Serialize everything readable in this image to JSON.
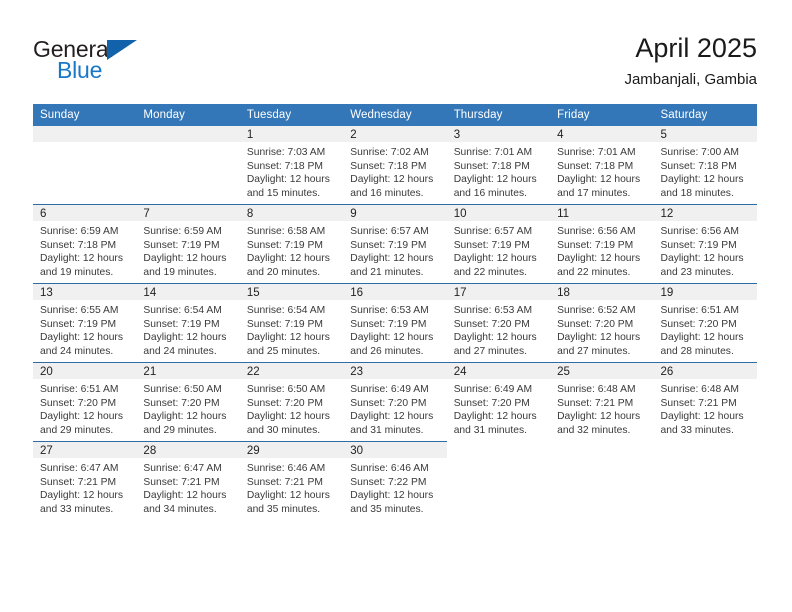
{
  "brand": {
    "name_part1": "General",
    "name_part2": "Blue",
    "triangle_icon": "triangle-icon",
    "accent_color": "#1162ab",
    "blue_text_color": "#1878c8"
  },
  "header": {
    "title": "April 2025",
    "location": "Jambanjali, Gambia"
  },
  "calendar": {
    "header_background": "#3477b8",
    "daynum_background": "#f0f0f0",
    "row_separator_color": "#2e6da4",
    "weekdays": [
      "Sunday",
      "Monday",
      "Tuesday",
      "Wednesday",
      "Thursday",
      "Friday",
      "Saturday"
    ],
    "weeks": [
      [
        {
          "day": "",
          "empty": true
        },
        {
          "day": "",
          "empty": true
        },
        {
          "day": "1",
          "sunrise": "Sunrise: 7:03 AM",
          "sunset": "Sunset: 7:18 PM",
          "daylight": "Daylight: 12 hours and 15 minutes."
        },
        {
          "day": "2",
          "sunrise": "Sunrise: 7:02 AM",
          "sunset": "Sunset: 7:18 PM",
          "daylight": "Daylight: 12 hours and 16 minutes."
        },
        {
          "day": "3",
          "sunrise": "Sunrise: 7:01 AM",
          "sunset": "Sunset: 7:18 PM",
          "daylight": "Daylight: 12 hours and 16 minutes."
        },
        {
          "day": "4",
          "sunrise": "Sunrise: 7:01 AM",
          "sunset": "Sunset: 7:18 PM",
          "daylight": "Daylight: 12 hours and 17 minutes."
        },
        {
          "day": "5",
          "sunrise": "Sunrise: 7:00 AM",
          "sunset": "Sunset: 7:18 PM",
          "daylight": "Daylight: 12 hours and 18 minutes."
        }
      ],
      [
        {
          "day": "6",
          "sunrise": "Sunrise: 6:59 AM",
          "sunset": "Sunset: 7:18 PM",
          "daylight": "Daylight: 12 hours and 19 minutes."
        },
        {
          "day": "7",
          "sunrise": "Sunrise: 6:59 AM",
          "sunset": "Sunset: 7:19 PM",
          "daylight": "Daylight: 12 hours and 19 minutes."
        },
        {
          "day": "8",
          "sunrise": "Sunrise: 6:58 AM",
          "sunset": "Sunset: 7:19 PM",
          "daylight": "Daylight: 12 hours and 20 minutes."
        },
        {
          "day": "9",
          "sunrise": "Sunrise: 6:57 AM",
          "sunset": "Sunset: 7:19 PM",
          "daylight": "Daylight: 12 hours and 21 minutes."
        },
        {
          "day": "10",
          "sunrise": "Sunrise: 6:57 AM",
          "sunset": "Sunset: 7:19 PM",
          "daylight": "Daylight: 12 hours and 22 minutes."
        },
        {
          "day": "11",
          "sunrise": "Sunrise: 6:56 AM",
          "sunset": "Sunset: 7:19 PM",
          "daylight": "Daylight: 12 hours and 22 minutes."
        },
        {
          "day": "12",
          "sunrise": "Sunrise: 6:56 AM",
          "sunset": "Sunset: 7:19 PM",
          "daylight": "Daylight: 12 hours and 23 minutes."
        }
      ],
      [
        {
          "day": "13",
          "sunrise": "Sunrise: 6:55 AM",
          "sunset": "Sunset: 7:19 PM",
          "daylight": "Daylight: 12 hours and 24 minutes."
        },
        {
          "day": "14",
          "sunrise": "Sunrise: 6:54 AM",
          "sunset": "Sunset: 7:19 PM",
          "daylight": "Daylight: 12 hours and 24 minutes."
        },
        {
          "day": "15",
          "sunrise": "Sunrise: 6:54 AM",
          "sunset": "Sunset: 7:19 PM",
          "daylight": "Daylight: 12 hours and 25 minutes."
        },
        {
          "day": "16",
          "sunrise": "Sunrise: 6:53 AM",
          "sunset": "Sunset: 7:19 PM",
          "daylight": "Daylight: 12 hours and 26 minutes."
        },
        {
          "day": "17",
          "sunrise": "Sunrise: 6:53 AM",
          "sunset": "Sunset: 7:20 PM",
          "daylight": "Daylight: 12 hours and 27 minutes."
        },
        {
          "day": "18",
          "sunrise": "Sunrise: 6:52 AM",
          "sunset": "Sunset: 7:20 PM",
          "daylight": "Daylight: 12 hours and 27 minutes."
        },
        {
          "day": "19",
          "sunrise": "Sunrise: 6:51 AM",
          "sunset": "Sunset: 7:20 PM",
          "daylight": "Daylight: 12 hours and 28 minutes."
        }
      ],
      [
        {
          "day": "20",
          "sunrise": "Sunrise: 6:51 AM",
          "sunset": "Sunset: 7:20 PM",
          "daylight": "Daylight: 12 hours and 29 minutes."
        },
        {
          "day": "21",
          "sunrise": "Sunrise: 6:50 AM",
          "sunset": "Sunset: 7:20 PM",
          "daylight": "Daylight: 12 hours and 29 minutes."
        },
        {
          "day": "22",
          "sunrise": "Sunrise: 6:50 AM",
          "sunset": "Sunset: 7:20 PM",
          "daylight": "Daylight: 12 hours and 30 minutes."
        },
        {
          "day": "23",
          "sunrise": "Sunrise: 6:49 AM",
          "sunset": "Sunset: 7:20 PM",
          "daylight": "Daylight: 12 hours and 31 minutes."
        },
        {
          "day": "24",
          "sunrise": "Sunrise: 6:49 AM",
          "sunset": "Sunset: 7:20 PM",
          "daylight": "Daylight: 12 hours and 31 minutes."
        },
        {
          "day": "25",
          "sunrise": "Sunrise: 6:48 AM",
          "sunset": "Sunset: 7:21 PM",
          "daylight": "Daylight: 12 hours and 32 minutes."
        },
        {
          "day": "26",
          "sunrise": "Sunrise: 6:48 AM",
          "sunset": "Sunset: 7:21 PM",
          "daylight": "Daylight: 12 hours and 33 minutes."
        }
      ],
      [
        {
          "day": "27",
          "sunrise": "Sunrise: 6:47 AM",
          "sunset": "Sunset: 7:21 PM",
          "daylight": "Daylight: 12 hours and 33 minutes."
        },
        {
          "day": "28",
          "sunrise": "Sunrise: 6:47 AM",
          "sunset": "Sunset: 7:21 PM",
          "daylight": "Daylight: 12 hours and 34 minutes."
        },
        {
          "day": "29",
          "sunrise": "Sunrise: 6:46 AM",
          "sunset": "Sunset: 7:21 PM",
          "daylight": "Daylight: 12 hours and 35 minutes."
        },
        {
          "day": "30",
          "sunrise": "Sunrise: 6:46 AM",
          "sunset": "Sunset: 7:22 PM",
          "daylight": "Daylight: 12 hours and 35 minutes."
        },
        {
          "day": "",
          "empty": true,
          "blank": true
        },
        {
          "day": "",
          "empty": true,
          "blank": true
        },
        {
          "day": "",
          "empty": true,
          "blank": true
        }
      ]
    ]
  }
}
